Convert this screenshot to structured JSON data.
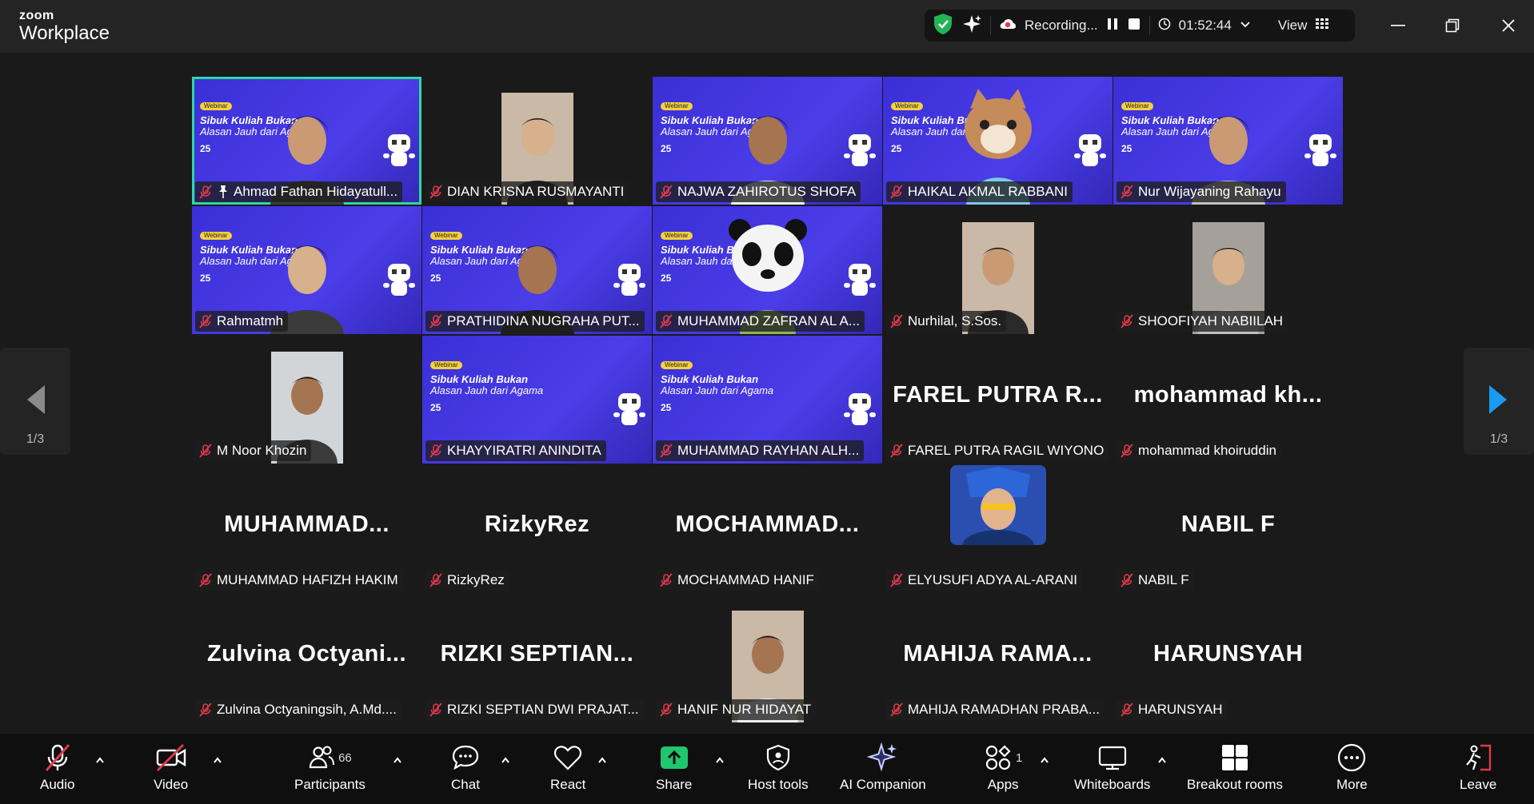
{
  "app": {
    "logo_line1": "zoom",
    "logo_line2": "Workplace"
  },
  "status": {
    "recording_label": "Recording...",
    "timer": "01:52:44",
    "view_label": "View"
  },
  "banner": {
    "tag": "Webinar",
    "line1": "Sibuk Kuliah Bukan",
    "line2": "Alasan Jauh dari Agama",
    "date": "25"
  },
  "gallery": {
    "page_left": "1/3",
    "page_right": "1/3",
    "tiles": [
      {
        "name": "Ahmad Fathan Hidayatull...",
        "big": ""
      },
      {
        "name": "DIAN KRISNA RUSMAYANTI",
        "big": ""
      },
      {
        "name": "NAJWA ZAHIROTUS SHOFA",
        "big": ""
      },
      {
        "name": "HAIKAL AKMAL RABBANI",
        "big": ""
      },
      {
        "name": "Nur Wijayaning Rahayu",
        "big": ""
      },
      {
        "name": "Rahmatmh",
        "big": ""
      },
      {
        "name": "PRATHIDINA NUGRAHA PUT...",
        "big": ""
      },
      {
        "name": "MUHAMMAD ZAFRAN AL A...",
        "big": ""
      },
      {
        "name": "Nurhilal, S.Sos.",
        "big": ""
      },
      {
        "name": "SHOOFIYAH NABIILAH",
        "big": ""
      },
      {
        "name": "M Noor Khozin",
        "big": ""
      },
      {
        "name": "KHAYYIRATRI ANINDITA",
        "big": ""
      },
      {
        "name": "MUHAMMAD RAYHAN ALH...",
        "big": ""
      },
      {
        "name": "FAREL PUTRA RAGIL WIYONO",
        "big": "FAREL  PUTRA  R..."
      },
      {
        "name": "mohammad khoiruddin",
        "big": "mohammad  kh..."
      },
      {
        "name": "MUHAMMAD HAFIZH HAKIM",
        "big": "MUHAMMAD..."
      },
      {
        "name": "RizkyRez",
        "big": "RizkyRez"
      },
      {
        "name": "MOCHAMMAD HANIF",
        "big": "MOCHAMMAD..."
      },
      {
        "name": "ELYUSUFI ADYA AL-ARANI",
        "big": ""
      },
      {
        "name": "NABIL F",
        "big": "NABIL F"
      },
      {
        "name": "Zulvina Octyaningsih, A.Md....",
        "big": "Zulvina  Octyani..."
      },
      {
        "name": "RIZKI SEPTIAN DWI PRAJAT...",
        "big": "RIZKI  SEPTIAN..."
      },
      {
        "name": "HANIF NUR HIDAYAT",
        "big": ""
      },
      {
        "name": "MAHIJA RAMADHAN PRABA...",
        "big": "MAHIJA  RAMA..."
      },
      {
        "name": "HARUNSYAH",
        "big": "HARUNSYAH"
      }
    ]
  },
  "toolbar": {
    "audio": "Audio",
    "video": "Video",
    "participants": "Participants",
    "participants_count": "66",
    "chat": "Chat",
    "react": "React",
    "share": "Share",
    "host_tools": "Host tools",
    "ai_companion": "AI Companion",
    "apps": "Apps",
    "apps_count": "1",
    "whiteboards": "Whiteboards",
    "breakout_rooms": "Breakout rooms",
    "more": "More",
    "leave": "Leave"
  },
  "colors": {
    "active_speaker": "#2ed8a3",
    "webinar_bg": "#4338e0",
    "share_green": "#1fc66d",
    "muted_red": "#e0394a",
    "leave_red": "#e0394a"
  }
}
